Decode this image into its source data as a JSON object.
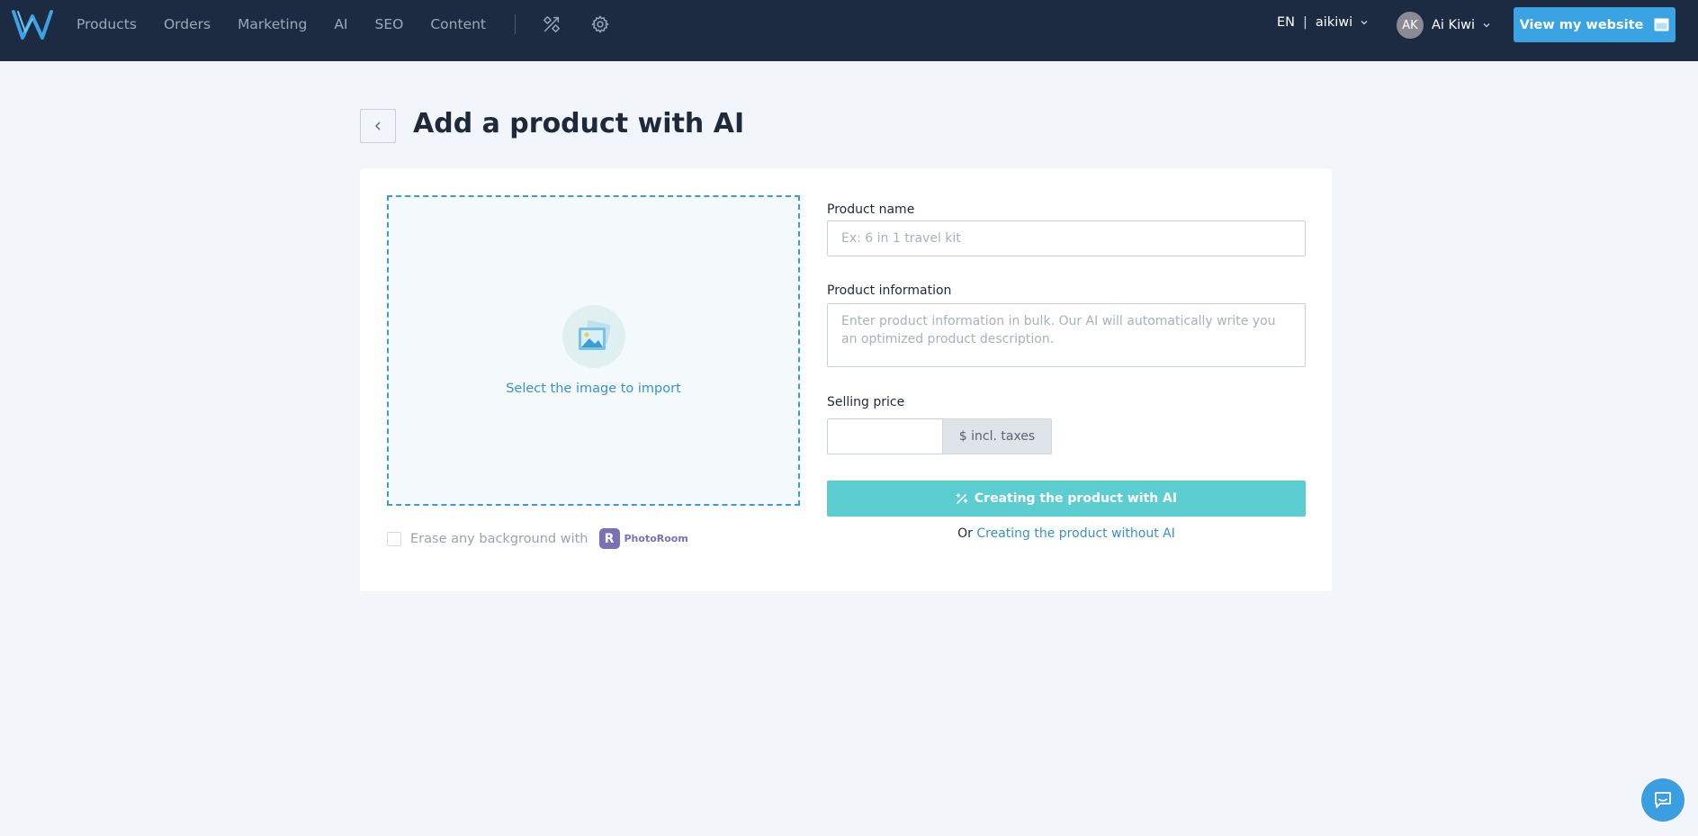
{
  "brand": {
    "logo_icon": "wizishop-w-logo-icon",
    "accent": "#3aa3e3",
    "topbar_bg": "#1c2b42"
  },
  "nav": {
    "items": [
      "Products",
      "Orders",
      "Marketing",
      "AI",
      "SEO",
      "Content"
    ],
    "icons": [
      "design-tools-icon",
      "gear-icon"
    ]
  },
  "account": {
    "lang": "EN",
    "shop": "aikiwi",
    "avatar_initials": "AK",
    "user_name": "Ai Kiwi",
    "view_site_label": "View my website"
  },
  "page": {
    "title": "Add a product with AI"
  },
  "image_import": {
    "label": "Select the image to import",
    "erase_label": "Erase any background with",
    "erase_checked": false,
    "partner": "PhotoRoom",
    "partner_mark": "R"
  },
  "form": {
    "name_label": "Product name",
    "name_placeholder": "Ex: 6 in 1 travel kit",
    "info_label": "Product information",
    "info_placeholder": "Enter product information in bulk. Our AI will automatically write you an optimized product description.",
    "price_label": "Selling price",
    "price_value": "",
    "price_suffix": "$ incl. taxes",
    "ai_button": "Creating the product with AI",
    "or_text": "Or",
    "without_ai_link": "Creating the product without AI"
  },
  "colors": {
    "ai_button": "#5ccdd0",
    "link": "#3a93c8",
    "dropzone_border": "#3a9ed6"
  }
}
